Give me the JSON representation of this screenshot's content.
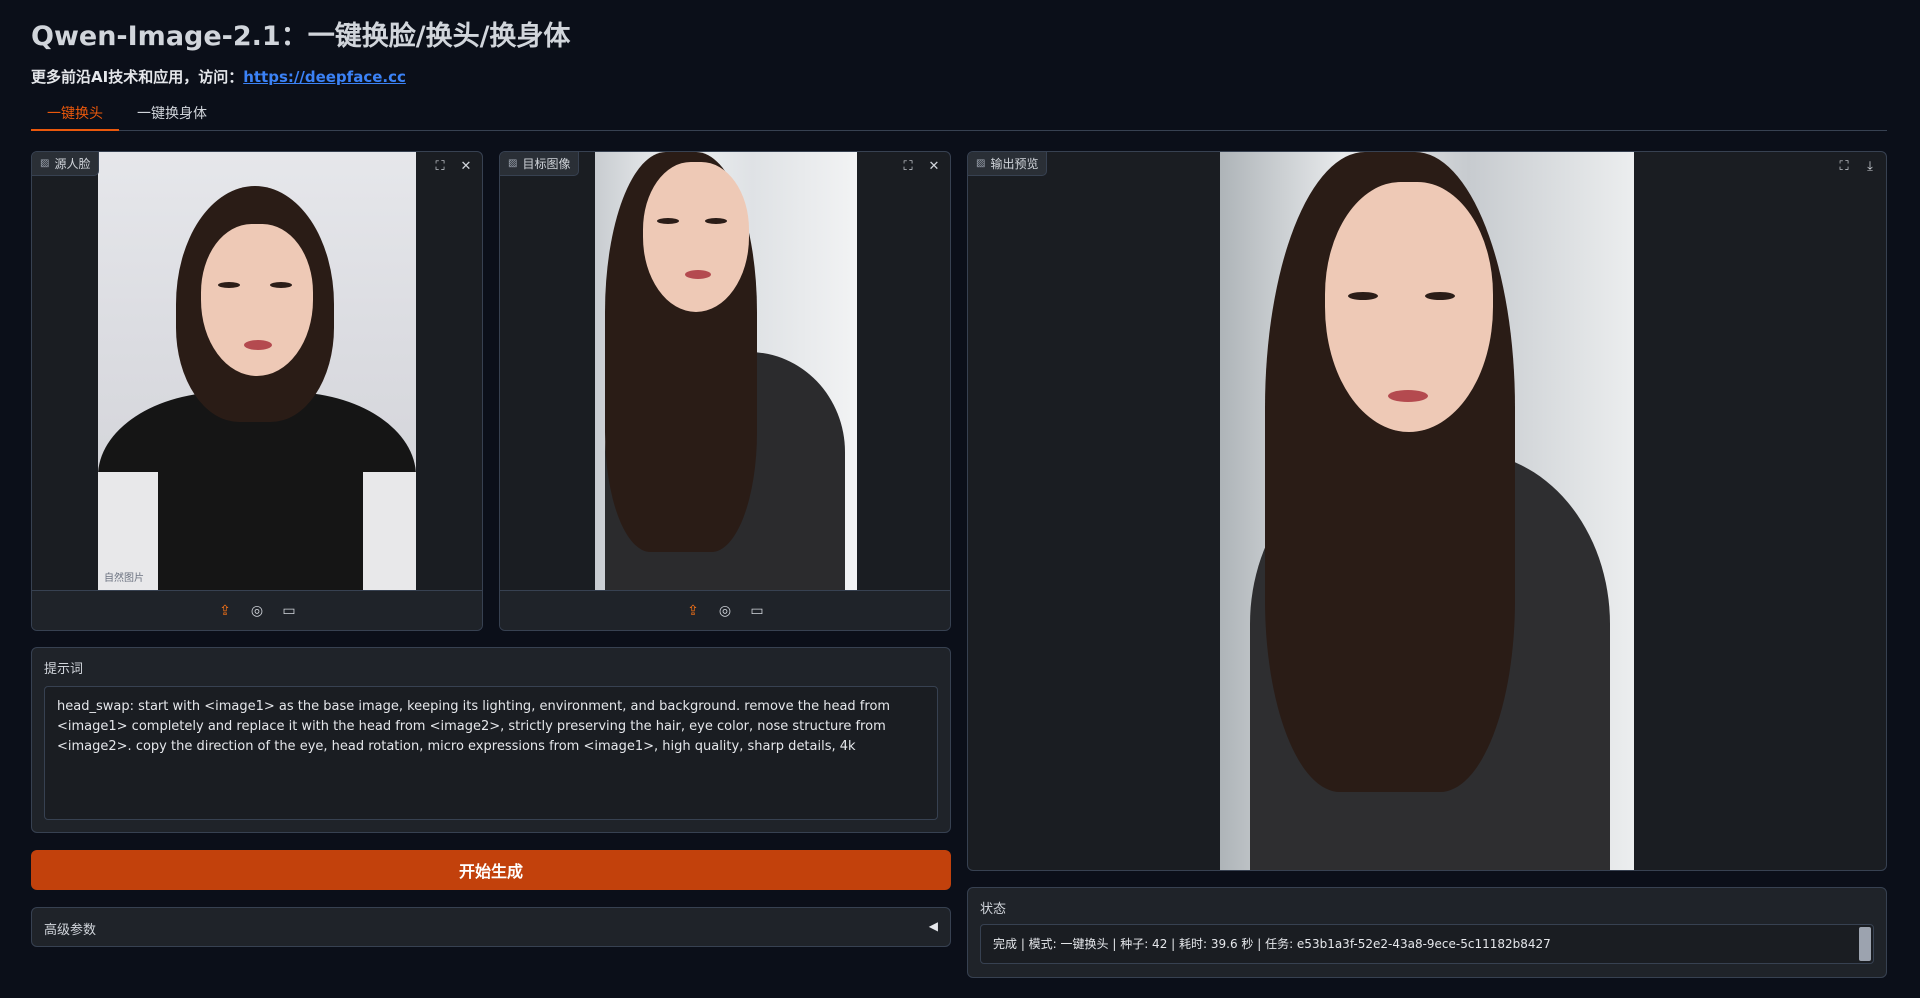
{
  "header": {
    "title": "Qwen-Image-2.1：一键换脸/换头/换身体",
    "subtitle_prefix": "更多前沿AI技术和应用，访问：",
    "link_text": "https://deepface.cc"
  },
  "tabs": [
    {
      "label": "一键换头",
      "active": true
    },
    {
      "label": "一键换身体",
      "active": false
    }
  ],
  "source_panel": {
    "label": "源人脸",
    "watermark": "自然图片"
  },
  "target_panel": {
    "label": "目标图像"
  },
  "output_panel": {
    "label": "输出预览"
  },
  "prompt": {
    "label": "提示词",
    "value": "head_swap: start with <image1> as the base image, keeping its lighting, environment, and background. remove the head from <image1> completely and replace it with the head from <image2>, strictly preserving the hair, eye color, nose structure from <image2>. copy the direction of the eye, head rotation, micro expressions from <image1>, high quality, sharp details, 4k"
  },
  "generate_button": "开始生成",
  "advanced": {
    "label": "高级参数",
    "arrow": "◀"
  },
  "status": {
    "label": "状态",
    "value": "完成 | 模式: 一键换头 | 种子: 42 | 耗时: 39.6 秒 | 任务: e53b1a3f-52e2-43a8-9ece-5c11182b8427"
  },
  "icons": {
    "image": "▨",
    "fullscreen": "⛶",
    "close": "✕",
    "download": "⤓",
    "upload": "⇪",
    "camera": "◎",
    "clipboard": "▭"
  },
  "colors": {
    "accent": "#ea580c",
    "button": "#c2410c",
    "link": "#3b82f6",
    "background": "#0b0f19"
  }
}
